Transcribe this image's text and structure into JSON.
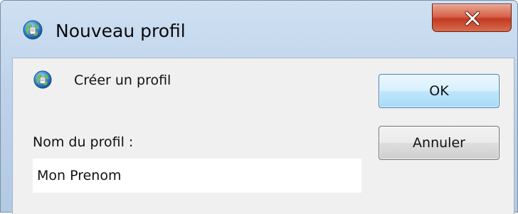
{
  "window": {
    "title": "Nouveau profil",
    "icon": "profile-globe-icon",
    "close_icon": "close-icon",
    "close_color": "#c94a30"
  },
  "content": {
    "heading": "Créer un profil",
    "heading_icon": "profile-globe-icon",
    "field_label": "Nom du profil :",
    "field_value": "Mon Prenom"
  },
  "buttons": {
    "ok_label": "OK",
    "cancel_label": "Annuler",
    "ok_border_color": "#3c7fb1"
  }
}
